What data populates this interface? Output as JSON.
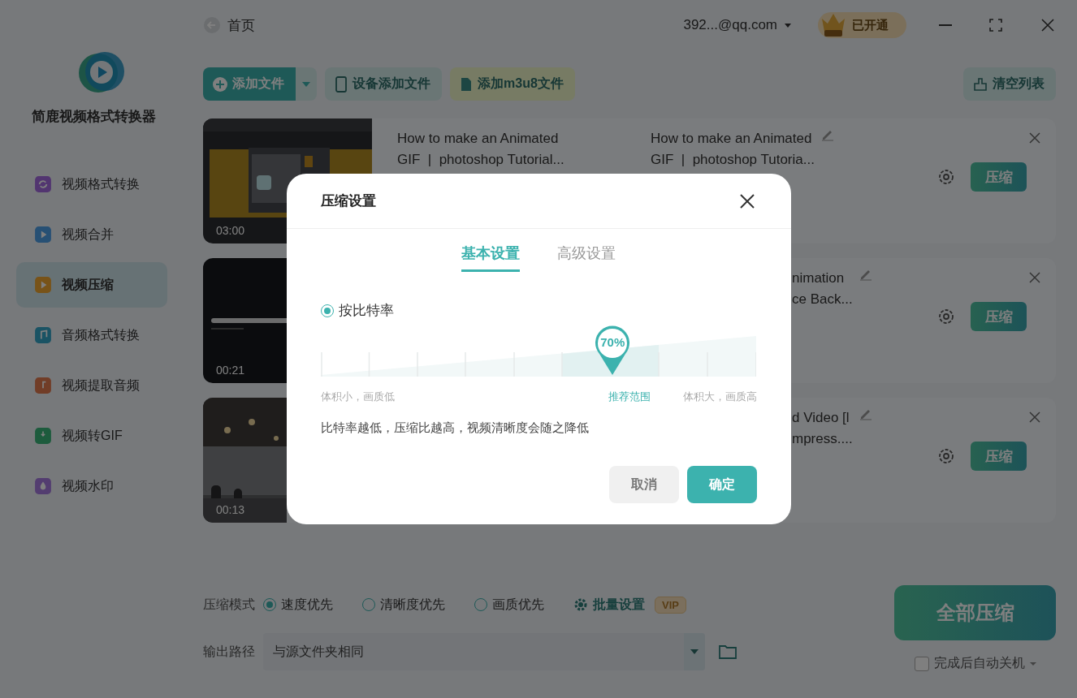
{
  "app": {
    "name": "简鹿视频格式转换器"
  },
  "sidebar": {
    "items": [
      {
        "label": "视频格式转换",
        "selected": false
      },
      {
        "label": "视频合并",
        "selected": false
      },
      {
        "label": "视频压缩",
        "selected": true
      },
      {
        "label": "音频格式转换",
        "selected": false
      },
      {
        "label": "视频提取音频",
        "selected": false
      },
      {
        "label": "视频转GIF",
        "selected": false
      },
      {
        "label": "视频水印",
        "selected": false
      }
    ]
  },
  "topbar": {
    "back": "首页",
    "account": "392...@qq.com",
    "vip": "已开通"
  },
  "toolbar": {
    "add_file": "添加文件",
    "device_add": "设备添加文件",
    "add_m3u8": "添加m3u8文件",
    "clear": "清空列表"
  },
  "files": [
    {
      "duration": "03:00",
      "title_lines": [
        "How to make an Animated",
        "GIF  |  photoshop Tutorial..."
      ],
      "output_lines": [
        "How to make an Animated",
        "GIF  |  photoshop Tutoria..."
      ],
      "covered": false,
      "button": "压缩"
    },
    {
      "duration": "00:21",
      "output_lines": [
        "nimation",
        "ce Back..."
      ],
      "covered": true,
      "button": "压缩"
    },
    {
      "duration": "00:13",
      "output_lines": [
        "d Video [l",
        "mpress...."
      ],
      "covered": true,
      "button": "压缩"
    }
  ],
  "bottom": {
    "mode_label": "压缩模式",
    "modes": [
      {
        "label": "速度优先",
        "selected": true
      },
      {
        "label": "清晰度优先",
        "selected": false
      },
      {
        "label": "画质优先",
        "selected": false
      }
    ],
    "batch": "批量设置",
    "batch_badge": "VIP",
    "output_label": "输出路径",
    "output_value": "与源文件夹相同",
    "compress_all": "全部压缩",
    "shutdown": {
      "label": "完成后自动关机",
      "checked": false
    }
  },
  "dialog": {
    "title": "压缩设置",
    "tabs": [
      {
        "label": "基本设置",
        "selected": true
      },
      {
        "label": "高级设置",
        "selected": false
      }
    ],
    "mode": {
      "label": "按比特率",
      "selected": true
    },
    "slider": {
      "level": 0.67,
      "reading": "70%",
      "min_label": "体积小，画质低",
      "recommended": "推荐范围",
      "max_label": "体积大，画质高"
    },
    "hint": "比特率越低，压缩比越高，视频清晰度会随之降低",
    "cancel": "取消",
    "confirm": "确定"
  }
}
